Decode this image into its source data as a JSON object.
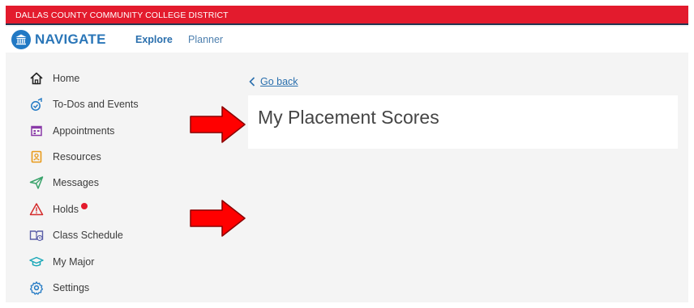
{
  "district": {
    "name": "DALLAS COUNTY COMMUNITY COLLEGE DISTRICT"
  },
  "header": {
    "brand": "NAVIGATE",
    "nav": {
      "explore": "Explore",
      "planner": "Planner"
    }
  },
  "sidebar": {
    "items": [
      {
        "label": "Home",
        "icon": "home-icon"
      },
      {
        "label": "To-Dos and Events",
        "icon": "todos-icon"
      },
      {
        "label": "Appointments",
        "icon": "calendar-icon"
      },
      {
        "label": "Resources",
        "icon": "resources-icon"
      },
      {
        "label": "Messages",
        "icon": "paper-plane-icon"
      },
      {
        "label": "Holds",
        "icon": "warning-icon"
      },
      {
        "label": "Class Schedule",
        "icon": "class-schedule-icon"
      },
      {
        "label": "My Major",
        "icon": "graduation-cap-icon"
      },
      {
        "label": "Settings",
        "icon": "gear-icon"
      }
    ]
  },
  "main": {
    "back_label": "Go back",
    "page_title": "My Placement Scores"
  },
  "colors": {
    "district_bar": "#e31b2d",
    "brand_blue": "#2279c4",
    "link": "#2a6fad",
    "annotation_arrow": "#ff0000"
  }
}
